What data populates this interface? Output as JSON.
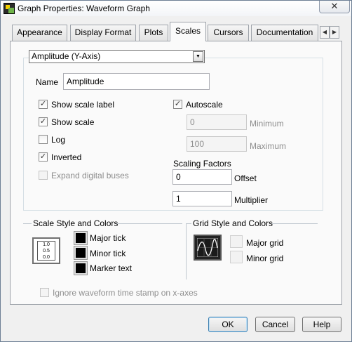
{
  "window": {
    "title": "Graph Properties: Waveform Graph",
    "close_glyph": "✕",
    "app_icon": "labview-vi-icon"
  },
  "tabs": [
    {
      "label": "Appearance",
      "active": false
    },
    {
      "label": "Display Format",
      "active": false
    },
    {
      "label": "Plots",
      "active": false
    },
    {
      "label": "Scales",
      "active": true
    },
    {
      "label": "Cursors",
      "active": false
    },
    {
      "label": "Documentation",
      "active": false
    }
  ],
  "tab_scroll": {
    "left": "◀",
    "right": "▶"
  },
  "scales": {
    "selected_axis": "Amplitude (Y-Axis)",
    "dropdown_glyph": "▼",
    "name_label": "Name",
    "name_value": "Amplitude",
    "options": [
      {
        "label": "Show scale label",
        "checked": true,
        "enabled": true
      },
      {
        "label": "Show scale",
        "checked": true,
        "enabled": true
      },
      {
        "label": "Log",
        "checked": false,
        "enabled": true
      },
      {
        "label": "Inverted",
        "checked": true,
        "enabled": true
      },
      {
        "label": "Expand digital buses",
        "checked": false,
        "enabled": false
      }
    ],
    "autoscale": {
      "label": "Autoscale",
      "checked": true
    },
    "minimum": {
      "label": "Minimum",
      "value": "0",
      "enabled": false
    },
    "maximum": {
      "label": "Maximum",
      "value": "100",
      "enabled": false
    },
    "scaling_factors": {
      "title": "Scaling Factors",
      "offset_label": "Offset",
      "offset_value": "0",
      "multiplier_label": "Multiplier",
      "multiplier_value": "1"
    },
    "check_glyph": "✓"
  },
  "scale_style": {
    "title": "Scale Style and Colors",
    "icon_lines": [
      "1.0",
      "0.5",
      "0.0"
    ],
    "colors": [
      {
        "label": "Major tick",
        "color": "#000000"
      },
      {
        "label": "Minor tick",
        "color": "#000000"
      },
      {
        "label": "Marker text",
        "color": "#000000"
      }
    ]
  },
  "grid_style": {
    "title": "Grid Style and Colors",
    "colors": [
      {
        "label": "Major grid",
        "enabled": false
      },
      {
        "label": "Minor grid",
        "enabled": false
      }
    ]
  },
  "ignore_timestamp": {
    "label": "Ignore waveform time stamp on x-axes",
    "checked": false,
    "enabled": false
  },
  "buttons": {
    "ok": "OK",
    "cancel": "Cancel",
    "help": "Help"
  }
}
